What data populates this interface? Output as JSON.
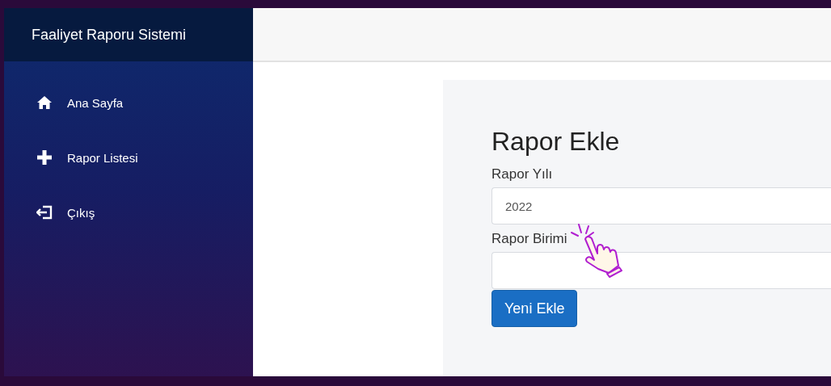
{
  "sidebar": {
    "title": "Faaliyet Raporu Sistemi",
    "items": [
      {
        "label": "Ana Sayfa",
        "kind": "home"
      },
      {
        "label": "Rapor Listesi",
        "kind": "add"
      },
      {
        "label": "Çıkış",
        "kind": "logout"
      }
    ]
  },
  "form": {
    "title": "Rapor Ekle",
    "fields": [
      {
        "label": "Rapor Yılı",
        "value": "2022"
      },
      {
        "label": "Rapor Birimi"
      }
    ],
    "button": "Yeni Ekle"
  }
}
